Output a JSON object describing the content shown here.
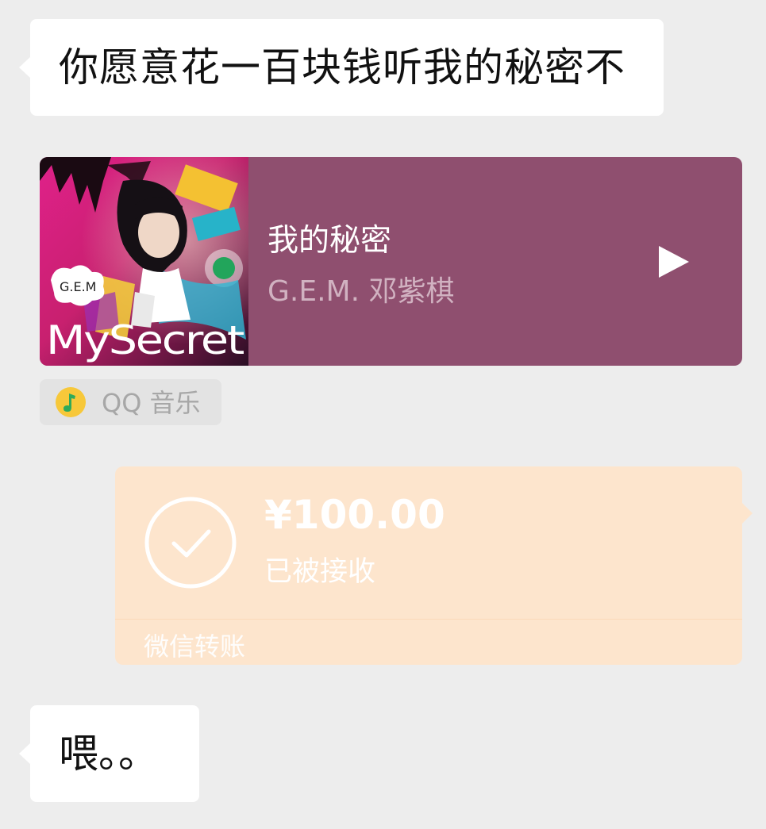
{
  "messages": {
    "first": "你愿意花一百块钱听我的秘密不",
    "last": "喂。。"
  },
  "music": {
    "title": "我的秘密",
    "artist": "G.E.M. 邓紫棋",
    "cover_text_logo": "G.E.M",
    "cover_text_title": "MySecret",
    "card_color": "#8f4f6f",
    "play_icon": "play-icon"
  },
  "source": {
    "label": "QQ 音乐",
    "icon": "qq-music-icon"
  },
  "transfer": {
    "amount": "¥100.00",
    "status": "已被接收",
    "footer": "微信转账",
    "card_color": "#fde5cd",
    "icon": "check-circle-icon"
  }
}
